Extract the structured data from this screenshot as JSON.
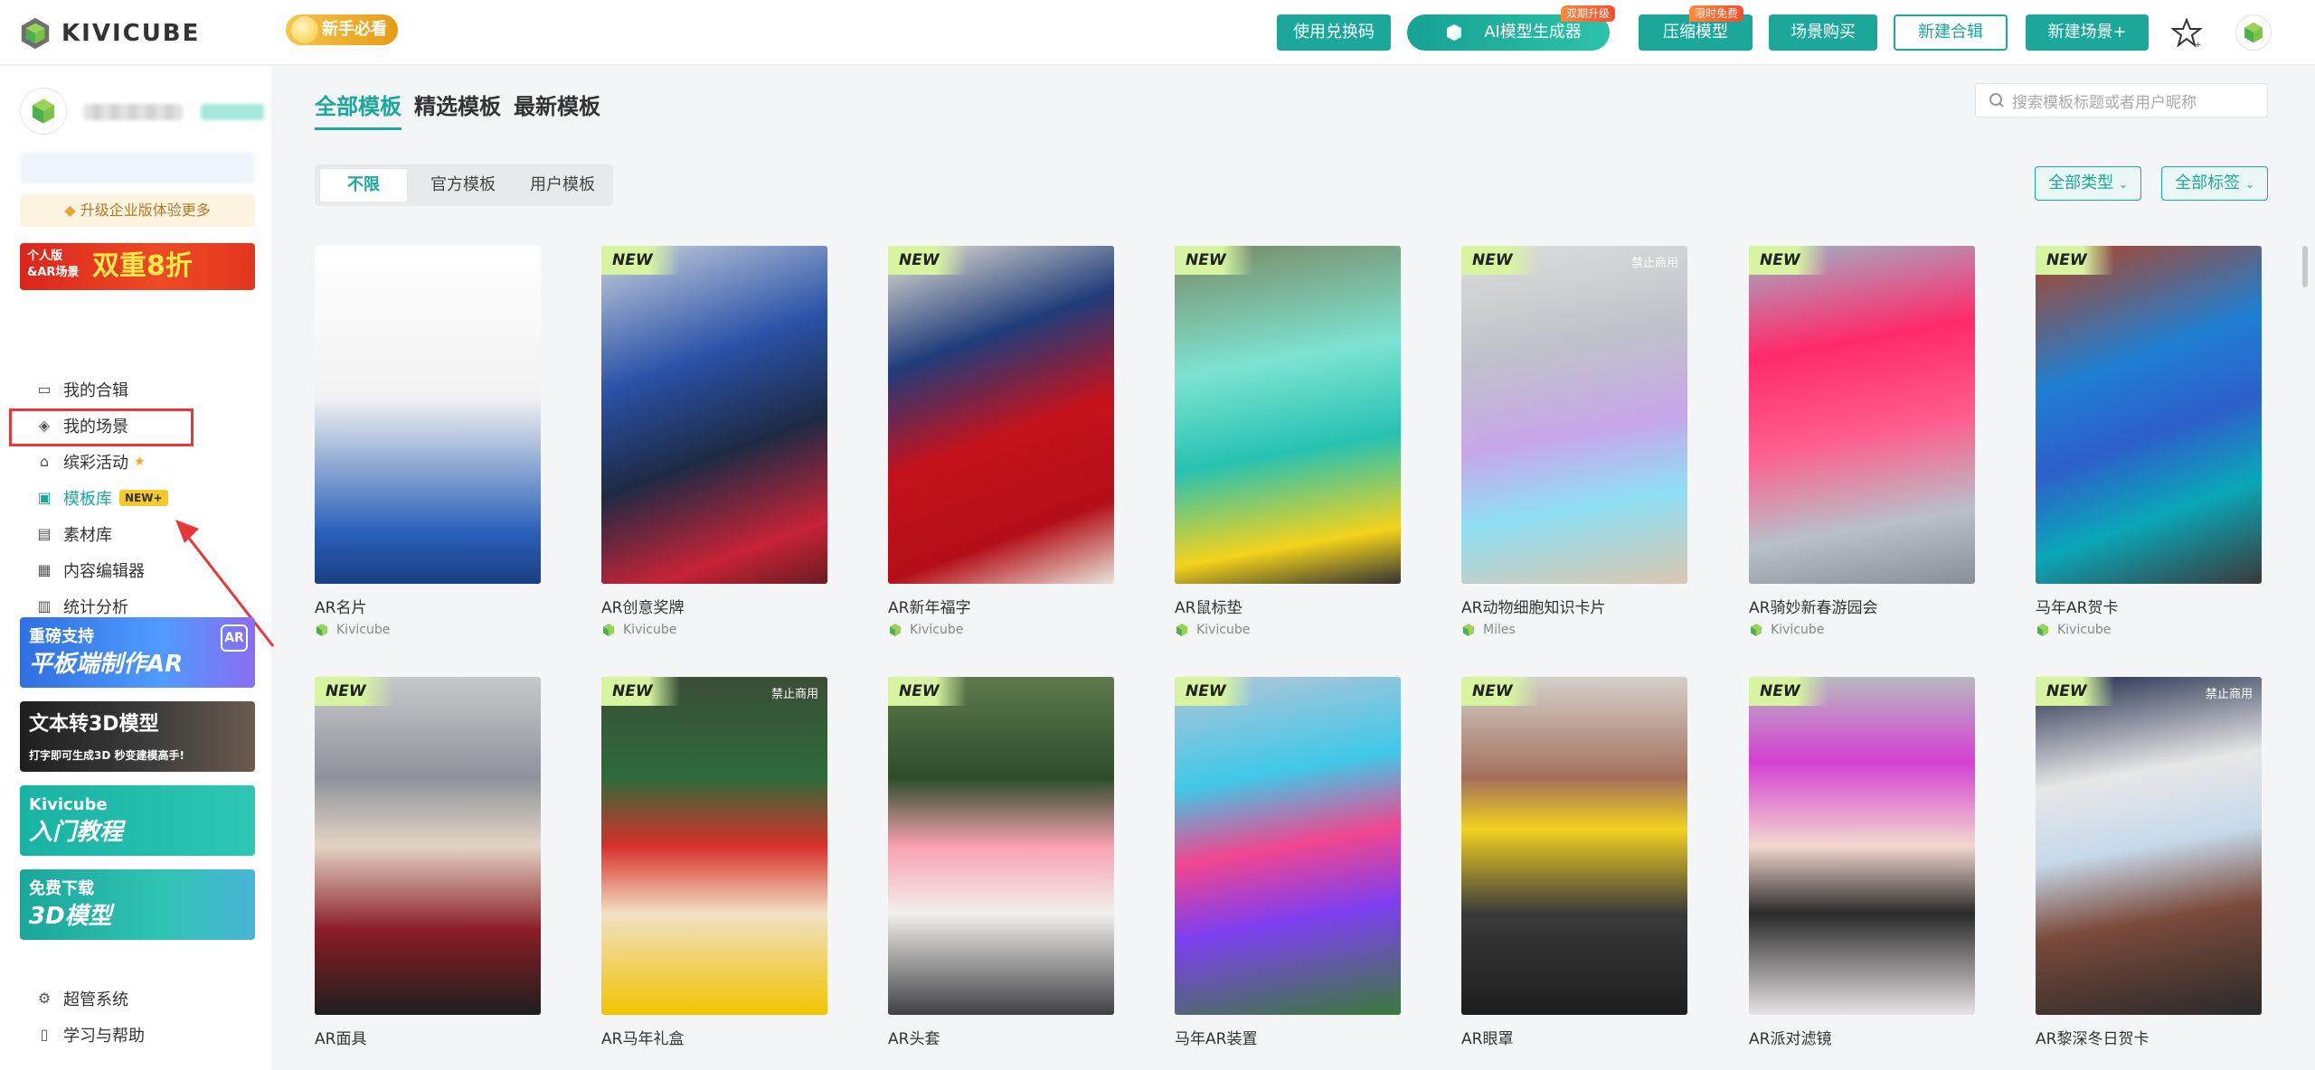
{
  "brand": {
    "name": "KIVICUBE",
    "accent": "#1ba89b"
  },
  "header": {
    "newbie": "新手必看",
    "redeem": "使用兑换码",
    "ai": "AI模型生成器",
    "ai_badge": "双期升级",
    "compress": "压缩模型",
    "compress_badge": "限时免费",
    "buy": "场景购买",
    "new_collection": "新建合辑",
    "new_scene": "新建场景+"
  },
  "sidebar": {
    "upgrade": "升级企业版体验更多",
    "promo_line1": "个人版",
    "promo_line2": "&AR场景",
    "promo_main": "双重8折",
    "items": [
      {
        "label": "我的合辑",
        "icon": "folder-icon"
      },
      {
        "label": "我的场景",
        "icon": "cube-icon"
      },
      {
        "label": "缤彩活动",
        "icon": "home-icon"
      },
      {
        "label": "模板库",
        "icon": "image-icon",
        "tag": "NEW+"
      },
      {
        "label": "素材库",
        "icon": "document-icon"
      },
      {
        "label": "内容编辑器",
        "icon": "editor-icon"
      },
      {
        "label": "统计分析",
        "icon": "chart-icon"
      }
    ],
    "banners": [
      {
        "line1": "重磅支持",
        "line2": "平板端制作AR",
        "badge": "AR"
      },
      {
        "line1": "文本转3D模型",
        "line2": "打字即可生成3D 秒变建模高手!"
      },
      {
        "line1": "Kivicube",
        "line2": "入门教程"
      },
      {
        "line1": "免费下载",
        "line2": "3D模型"
      }
    ],
    "footer": [
      {
        "label": "超管系统",
        "icon": "gear-icon"
      },
      {
        "label": "学习与帮助",
        "icon": "book-icon"
      }
    ]
  },
  "main": {
    "tabs": [
      "全部模板",
      "精选模板",
      "最新模板"
    ],
    "search_placeholder": "搜索模板标题或者用户昵称",
    "segments": [
      "不限",
      "官方模板",
      "用户模板"
    ],
    "filter_type": "全部类型",
    "filter_tag": "全部标签",
    "new_label": "NEW",
    "ban_label": "禁止商用",
    "cards": [
      {
        "title": "AR名片",
        "author": "Kivicube",
        "isNew": false,
        "ban": false,
        "bg": "linear-gradient(180deg,#ffffff 0%,#f2f2f2 45%,#2a5fb8 85%,#1a3f84 100%)"
      },
      {
        "title": "AR创意奖牌",
        "author": "Kivicube",
        "isNew": true,
        "ban": false,
        "bg": "linear-gradient(160deg,#c9d2de 0%,#2a52a8 35%,#1e2a44 60%,#c62336 85%,#6b1b22 100%)"
      },
      {
        "title": "AR新年福字",
        "author": "Kivicube",
        "isNew": true,
        "ban": false,
        "bg": "linear-gradient(160deg,#e9e4d8 0%,#1f3c7a 30%,#c4121c 55%,#b30f18 80%,#e9e4d8 100%)"
      },
      {
        "title": "AR鼠标垫",
        "author": "Kivicube",
        "isNew": true,
        "ban": false,
        "bg": "linear-gradient(170deg,#7a8a66 0%,#7de3d0 35%,#27c2b2 60%,#f4d31b 85%,#333 100%)"
      },
      {
        "title": "AR动物细胞知识卡片",
        "author": "Miles",
        "isNew": true,
        "ban": true,
        "bg": "linear-gradient(170deg,#ddd 0%,#bfc3c9 30%,#c7a6e9 55%,#8fe0f5 75%,#d9c7b0 100%)"
      },
      {
        "title": "AR骑妙新春游园会",
        "author": "Kivicube",
        "isNew": true,
        "ban": false,
        "bg": "linear-gradient(170deg,#9fb2c6 0%,#ff2a6a 30%,#ff5c8c 55%,#b8c0c8 80%,#8a8f96 100%)"
      },
      {
        "title": "马年AR贺卡",
        "author": "Kivicube",
        "isNew": true,
        "ban": false,
        "bg": "linear-gradient(160deg,#b3411f 0%,#1f7fd1 35%,#2d5fcb 55%,#0aa7b8 75%,#3a3a3a 100%)"
      },
      {
        "title": "AR面具",
        "author": "",
        "isNew": true,
        "ban": false,
        "bg": "linear-gradient(180deg,#c6c8cb 0%,#8f9399 30%,#e3d4c6 50%,#8a1d26 75%,#1e1e1e 100%)"
      },
      {
        "title": "AR马年礼盒",
        "author": "",
        "isNew": true,
        "ban": true,
        "bg": "linear-gradient(180deg,#3b4d38 0%,#2e6b3a 30%,#d8302a 50%,#f2e0c4 70%,#f2c400 100%)"
      },
      {
        "title": "AR头套",
        "author": "",
        "isNew": true,
        "ban": false,
        "bg": "linear-gradient(180deg,#5e7a4c 0%,#2d4d2a 30%,#f7a1b0 50%,#f2f0ec 70%,#404044 100%)"
      },
      {
        "title": "马年AR装置",
        "author": "",
        "isNew": true,
        "ban": false,
        "bg": "linear-gradient(170deg,#b4c5d8 0%,#40c8e8 30%,#f1468f 50%,#7d3ff0 70%,#3c7a3c 100%)"
      },
      {
        "title": "AR眼罩",
        "author": "",
        "isNew": true,
        "ban": false,
        "bg": "linear-gradient(180deg,#d4cfca 0%,#a4705c 30%,#f2d120 45%,#3a3a3a 70%,#1e1e1e 100%)"
      },
      {
        "title": "AR派对滤镜",
        "author": "",
        "isNew": true,
        "ban": false,
        "bg": "linear-gradient(180deg,#b8bac0 0%,#d43fd2 25%,#f4d8cf 50%,#2a2a2a 70%,#e8e2e5 100%)"
      },
      {
        "title": "AR黎深冬日贺卡",
        "author": "",
        "isNew": true,
        "ban": true,
        "bg": "linear-gradient(170deg,#1f2b4a 0%,#e7e7e7 30%,#c6d9ea 50%,#7b4a3b 70%,#2a2a2a 100%)"
      }
    ]
  }
}
